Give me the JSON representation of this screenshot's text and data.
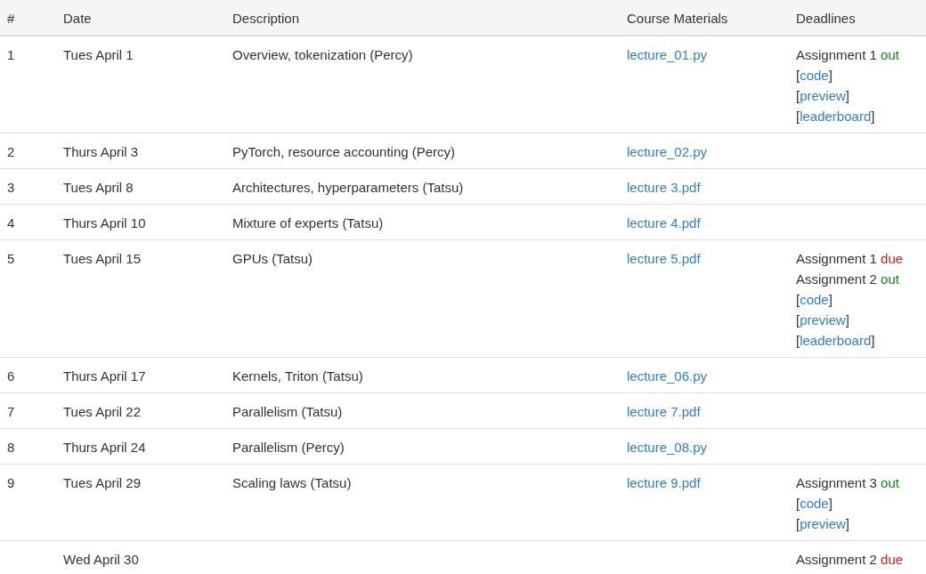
{
  "table": {
    "columns": [
      "#",
      "Date",
      "Description",
      "Course Materials",
      "Deadlines"
    ],
    "rows": [
      {
        "number": "1",
        "date": "Tues April 1",
        "description": "Overview, tokenization (Percy)",
        "material": "lecture_01.py",
        "deadlines": [
          {
            "kind": "assignment",
            "label": "Assignment 1",
            "status": "out",
            "color": "#118811"
          },
          {
            "kind": "link",
            "prefix": "[",
            "label": "code",
            "suffix": "]"
          },
          {
            "kind": "link",
            "prefix": "[",
            "label": "preview",
            "suffix": "]"
          },
          {
            "kind": "link",
            "prefix": "[",
            "label": "leaderboard",
            "suffix": "]"
          }
        ]
      },
      {
        "number": "2",
        "date": "Thurs April 3",
        "description": "PyTorch, resource accounting (Percy)",
        "material": "lecture_02.py"
      },
      {
        "number": "3",
        "date": "Tues April 8",
        "description": "Architectures, hyperparameters (Tatsu)",
        "material": "lecture 3.pdf"
      },
      {
        "number": "4",
        "date": "Thurs April 10",
        "description": "Mixture of experts (Tatsu)",
        "material": "lecture 4.pdf"
      },
      {
        "number": "5",
        "date": "Tues April 15",
        "description": "GPUs (Tatsu)",
        "material": "lecture 5.pdf",
        "deadlines": [
          {
            "kind": "assignment",
            "label": "Assignment 1",
            "status": "due",
            "color": "#e0201a"
          },
          {
            "kind": "assignment",
            "label": "Assignment 2",
            "status": "out",
            "color": "#118811"
          },
          {
            "kind": "link",
            "prefix": "[",
            "label": "code",
            "suffix": "]"
          },
          {
            "kind": "link",
            "prefix": "[",
            "label": "preview",
            "suffix": "]"
          },
          {
            "kind": "link",
            "prefix": "[",
            "label": "leaderboard",
            "suffix": "]"
          }
        ]
      },
      {
        "number": "6",
        "date": "Thurs April 17",
        "description": "Kernels, Triton (Tatsu)",
        "material": "lecture_06.py"
      },
      {
        "number": "7",
        "date": "Tues April 22",
        "description": "Parallelism (Tatsu)",
        "material": "lecture 7.pdf"
      },
      {
        "number": "8",
        "date": "Thurs April 24",
        "description": "Parallelism (Percy)",
        "material": "lecture_08.py"
      },
      {
        "number": "9",
        "date": "Tues April 29",
        "description": "Scaling laws (Tatsu)",
        "material": "lecture 9.pdf",
        "deadlines": [
          {
            "kind": "assignment",
            "label": "Assignment 3",
            "status": "out",
            "color": "#118811"
          },
          {
            "kind": "link",
            "prefix": "[",
            "label": "code",
            "suffix": "]"
          },
          {
            "kind": "link",
            "prefix": "[",
            "label": "preview",
            "suffix": "]"
          }
        ]
      },
      {
        "date": "Wed April 30",
        "deadlines": [
          {
            "kind": "assignment",
            "label": "Assignment 2",
            "status": "due",
            "color": "#e0201a"
          }
        ]
      }
    ]
  }
}
